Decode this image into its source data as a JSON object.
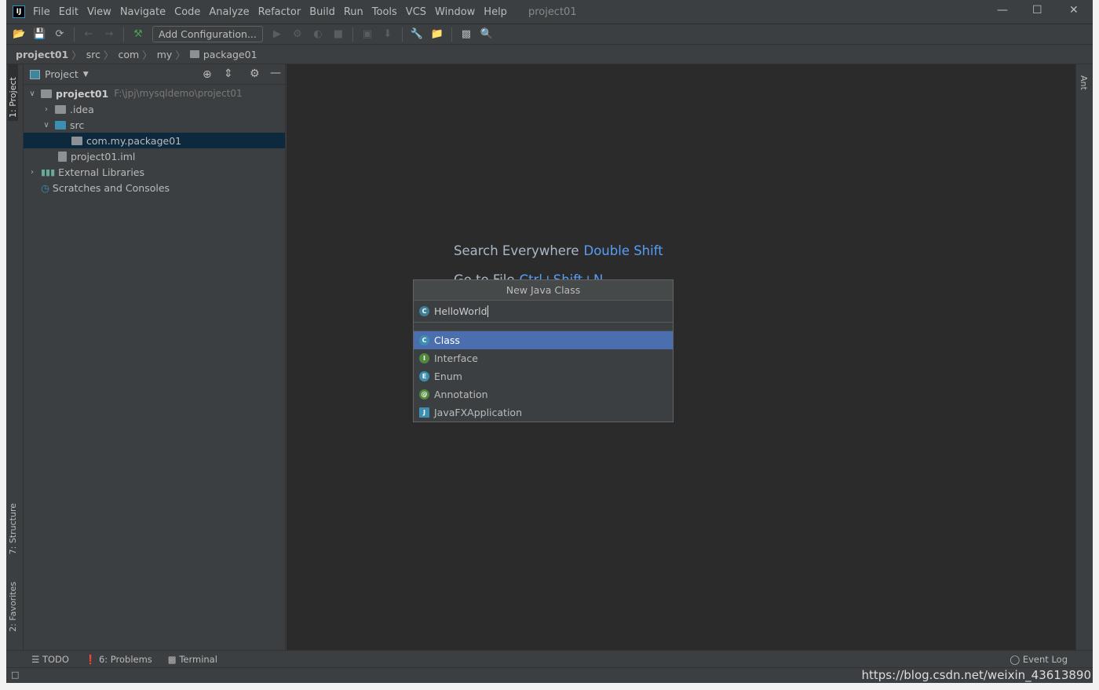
{
  "window": {
    "title": "project01",
    "logo": "IJ"
  },
  "menu": [
    "File",
    "Edit",
    "View",
    "Navigate",
    "Code",
    "Analyze",
    "Refactor",
    "Build",
    "Run",
    "Tools",
    "VCS",
    "Window",
    "Help"
  ],
  "toolbar": {
    "add_configuration": "Add Configuration..."
  },
  "breadcrumb": [
    "project01",
    "src",
    "com",
    "my",
    "package01"
  ],
  "left_tabs": {
    "project": "1: Project",
    "structure": "7: Structure",
    "favorites": "2: Favorites"
  },
  "right_tabs": {
    "ant": "Ant"
  },
  "project_panel": {
    "title": "Project",
    "tree": [
      {
        "label": "project01",
        "path": "F:\\jpj\\mysqldemo\\project01"
      },
      {
        "label": ".idea"
      },
      {
        "label": "src"
      },
      {
        "label": "com.my.package01",
        "selected": true
      },
      {
        "label": "project01.iml"
      },
      {
        "label": "External Libraries"
      },
      {
        "label": "Scratches and Consoles"
      }
    ]
  },
  "editor": {
    "hint_label": "Search Everywhere",
    "hint_key": "Double Shift",
    "hint2_label": "Go to File",
    "hint2_key": "Ctrl+Shift+N"
  },
  "dialog": {
    "title": "New Java Class",
    "name_value": "HelloWorld",
    "options": [
      {
        "label": "Class",
        "badge": "C",
        "color": "#3d8fb1",
        "selected": true
      },
      {
        "label": "Interface",
        "badge": "I",
        "color": "#4e8a3a"
      },
      {
        "label": "Enum",
        "badge": "E",
        "color": "#3d8fb1"
      },
      {
        "label": "Annotation",
        "badge": "@",
        "color": "#4e8a3a"
      },
      {
        "label": "JavaFXApplication",
        "badge": "J",
        "color": "#3d8fb1"
      }
    ]
  },
  "bottom_tools": {
    "todo": "TODO",
    "problems": "6: Problems",
    "terminal": "Terminal",
    "event_log": "Event Log"
  },
  "watermark": "https://blog.csdn.net/weixin_43613890"
}
